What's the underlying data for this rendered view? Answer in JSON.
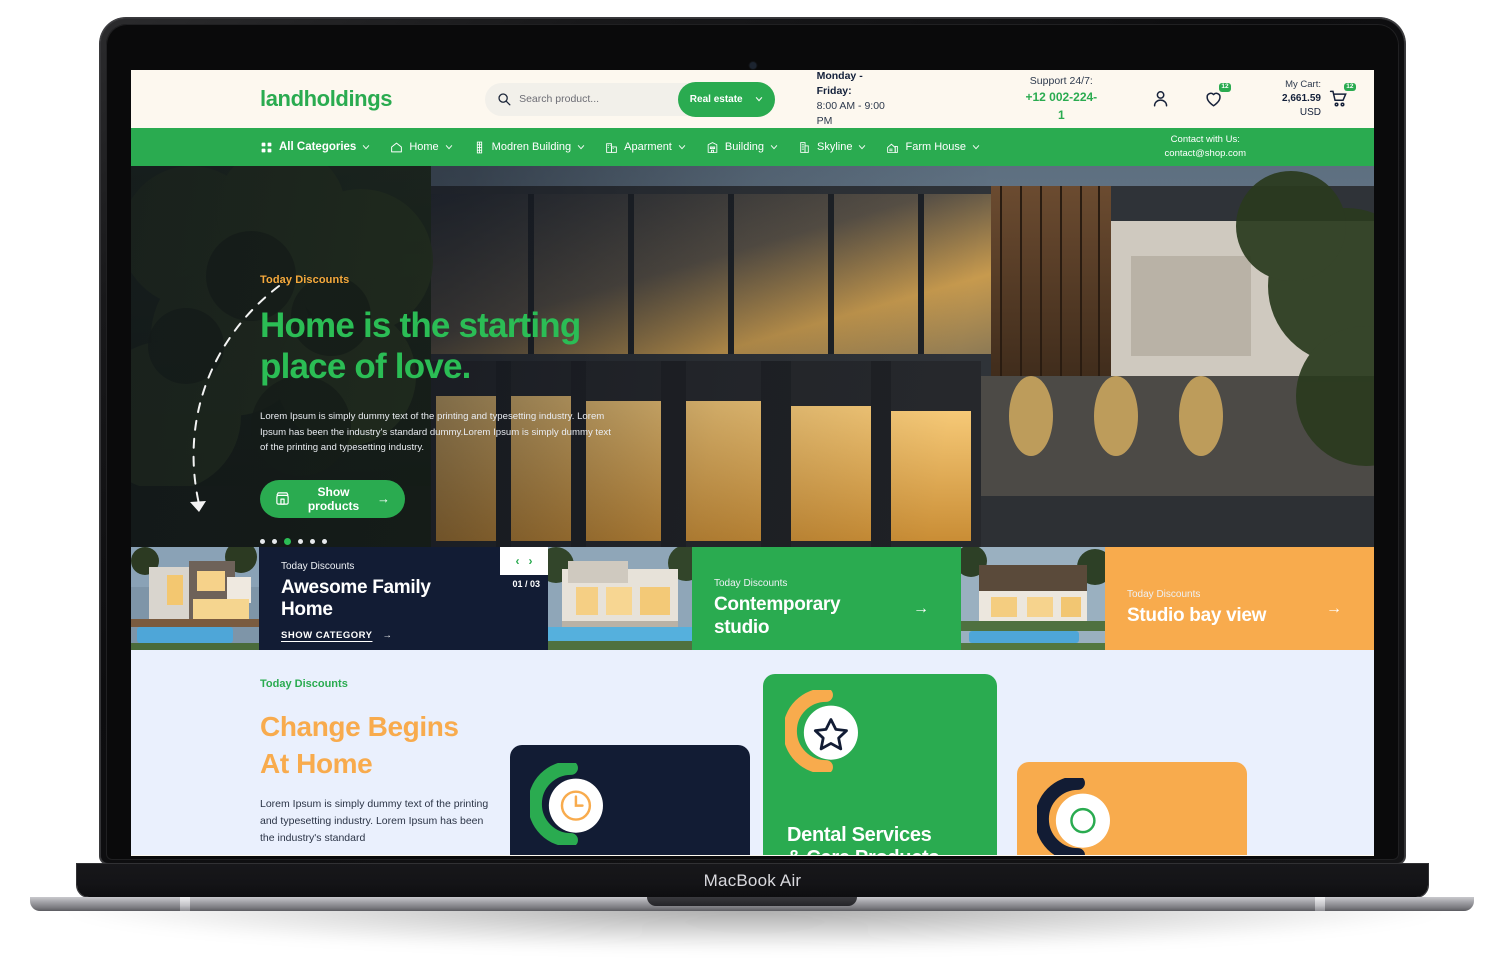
{
  "device": {
    "label": "MacBook Air"
  },
  "colors": {
    "brand_green": "#2aab50",
    "accent_orange": "#f8ab4d",
    "dark_navy": "#121c34",
    "cream": "#fdf8ef",
    "promo_bg": "#eaf0fd"
  },
  "header": {
    "logo": "landholdings",
    "search": {
      "placeholder": "Search product...",
      "value": "",
      "icon": "search-icon"
    },
    "category_pill": {
      "label": "Real estate",
      "icon": "chevron-down-icon"
    },
    "hours": {
      "days": "Monday - Friday:",
      "time": "8:00 AM - 9:00 PM"
    },
    "support": {
      "label": "Support 24/7:",
      "phone": "+12 002-224-1"
    },
    "account": {
      "icon": "user-icon"
    },
    "wishlist": {
      "icon": "heart-icon",
      "count": "12"
    },
    "cart": {
      "label": "My Cart:",
      "amount": "2,661.59",
      "currency": "USD",
      "icon": "cart-icon",
      "count": "12"
    }
  },
  "nav": {
    "items": [
      {
        "label": "All Categories",
        "icon": "grid-icon",
        "caret": true
      },
      {
        "label": "Home",
        "icon": "house-icon",
        "caret": true
      },
      {
        "label": "Modren Building",
        "icon": "tower-icon",
        "caret": true
      },
      {
        "label": "Aparment",
        "icon": "apartment-icon",
        "caret": true
      },
      {
        "label": "Building",
        "icon": "building-icon",
        "caret": true
      },
      {
        "label": "Skyline",
        "icon": "skyline-icon",
        "caret": true
      },
      {
        "label": "Farm House",
        "icon": "farmhouse-icon",
        "caret": true
      }
    ],
    "contact": {
      "label": "Contact with Us:",
      "email": "contact@shop.com"
    }
  },
  "hero": {
    "eyebrow": "Today Discounts",
    "title_line1": "Home is the starting",
    "title_line2": "place of love.",
    "paragraph": "Lorem Ipsum is simply dummy text of the printing and typesetting industry. Lorem Ipsum has been the industry's standard dummy.Lorem Ipsum is simply dummy text of the printing and typesetting industry.",
    "cta": {
      "label": "Show products",
      "icon": "store-icon",
      "arrow": "→"
    },
    "dots": {
      "count": 6,
      "active_index": 2
    }
  },
  "strip": {
    "cards": [
      {
        "eyebrow": "Today Discounts",
        "title_line1": "Awesome Family",
        "title_line2": "Home",
        "link": "SHOW CATEGORY",
        "arrow": "→",
        "prev": "‹",
        "next": "›",
        "counter": "01 / 03"
      },
      {
        "eyebrow": "Today Discounts",
        "title_line1": "Contemporary",
        "title_line2": "studio",
        "arrow": "→"
      },
      {
        "eyebrow": "Today Discounts",
        "title_line1": "Studio bay view",
        "title_line2": "",
        "arrow": "→"
      }
    ]
  },
  "promo": {
    "eyebrow": "Today Discounts",
    "title_line1": "Change Begins",
    "title_line2": "At Home",
    "paragraph": "Lorem Ipsum is simply dummy text of the printing and typesetting industry. Lorem Ipsum has been the industry's standard",
    "tiles": [
      {
        "name": "clock-tile",
        "icon": "clock-icon",
        "title": ""
      },
      {
        "name": "dental-tile",
        "icon": "star-icon",
        "title_line1": "Dental Services",
        "title_line2": "& Care Products."
      },
      {
        "name": "orange-tile",
        "icon": "circle-icon",
        "title": ""
      }
    ]
  }
}
